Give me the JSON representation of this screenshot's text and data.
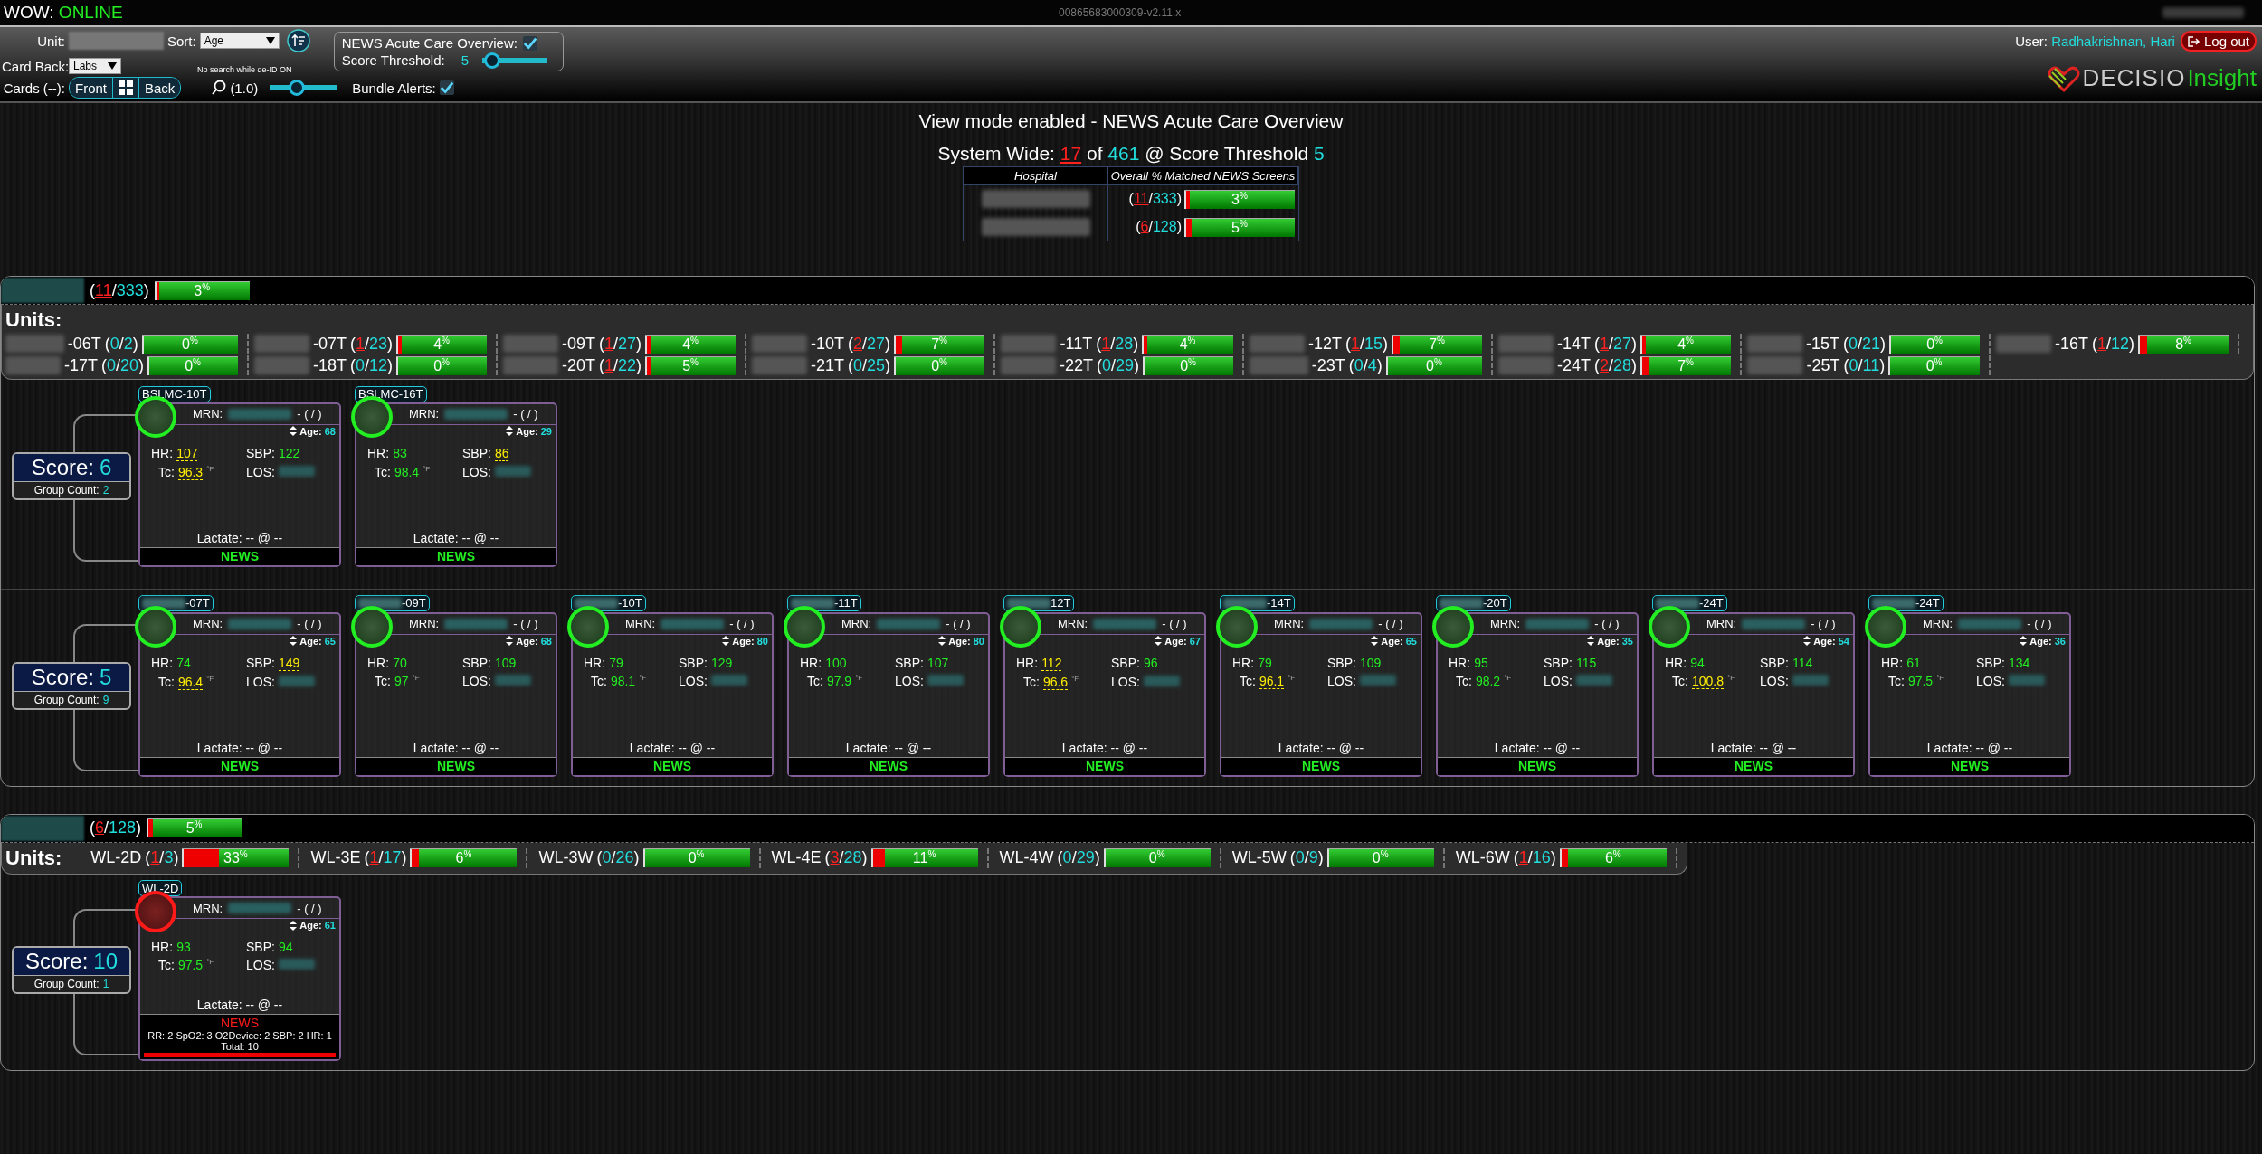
{
  "topbar": {
    "status_label": "WOW:",
    "status": "ONLINE",
    "build": "00865683000309-v2.11.x"
  },
  "toolbar": {
    "unit_label": "Unit:",
    "sort_label": "Sort:",
    "sort_value": "Age",
    "card_back_label": "Card Back:",
    "card_back_value": "Labs",
    "search_note": "No search while de-ID ON",
    "cards_label": "Cards (--):",
    "card_buttons": [
      {
        "kind": "text",
        "label": "Front"
      },
      {
        "kind": "grid"
      },
      {
        "kind": "text",
        "label": "Back"
      }
    ],
    "zoom_label": "(1.0)",
    "zoom": {
      "level": 0.4
    },
    "bundle": {
      "label": "Bundle Alerts:",
      "checked": true
    },
    "overview": {
      "label": "NEWS Acute Care Overview:",
      "checked": true
    },
    "threshold": {
      "label": "Score Threshold:",
      "value": "5",
      "level": 0.15
    }
  },
  "user": {
    "label": "User:",
    "name": "Radhakrishnan, Hari",
    "logout": "Log out"
  },
  "logo": {
    "part_1": "DECISIO",
    "part_2": "Insight"
  },
  "symbols": {
    "open": "(",
    "sep": "/",
    "close": ")"
  },
  "summary": {
    "title": "View mode enabled - NEWS Acute Care Overview",
    "label": "System Wide:",
    "matched": "17",
    "of": "of",
    "total": "461",
    "threshold_label": "@ Score Threshold",
    "threshold": "5",
    "columns": [
      "Hospital",
      "Overall % Matched NEWS Screens"
    ],
    "rows": [
      {
        "matched": "11",
        "total": "333",
        "percent": "3$^{%}$",
        "level": 0.03
      },
      {
        "matched": "6",
        "total": "128",
        "percent": "5$^{%}$",
        "level": 0.05
      }
    ]
  },
  "hospitals": [
    {
      "matched": "11",
      "total": "333",
      "percent": "3$^{%}$",
      "level": 0.03,
      "units_title": "Units:",
      "units": [
        {
          "name": "-06T",
          "redacted_prefix": true,
          "flagged": false,
          "matched": "0",
          "total": "2",
          "percent": "0$^{%}$",
          "level": 0
        },
        {
          "name": "-07T",
          "redacted_prefix": true,
          "flagged": true,
          "matched": "1",
          "total": "23",
          "percent": "4$^{%}$",
          "level": 0.04
        },
        {
          "name": "-09T",
          "redacted_prefix": true,
          "flagged": true,
          "matched": "1",
          "total": "27",
          "percent": "4$^{%}$",
          "level": 0.04
        },
        {
          "name": "-10T",
          "redacted_prefix": true,
          "flagged": true,
          "matched": "2",
          "total": "27",
          "percent": "7$^{%}$",
          "level": 0.07
        },
        {
          "name": "-11T",
          "redacted_prefix": true,
          "flagged": true,
          "matched": "1",
          "total": "28",
          "percent": "4$^{%}$",
          "level": 0.04
        },
        {
          "name": "-12T",
          "redacted_prefix": true,
          "flagged": true,
          "matched": "1",
          "total": "15",
          "percent": "7$^{%}$",
          "level": 0.07
        },
        {
          "name": "-14T",
          "redacted_prefix": true,
          "flagged": true,
          "matched": "1",
          "total": "27",
          "percent": "4$^{%}$",
          "level": 0.04
        },
        {
          "name": "-15T",
          "redacted_prefix": true,
          "flagged": false,
          "matched": "0",
          "total": "21",
          "percent": "0$^{%}$",
          "level": 0
        },
        {
          "name": "-16T",
          "redacted_prefix": true,
          "flagged": true,
          "matched": "1",
          "total": "12",
          "percent": "8$^{%}$",
          "level": 0.08
        },
        {
          "name": "-17T",
          "redacted_prefix": true,
          "flagged": false,
          "matched": "0",
          "total": "20",
          "percent": "0$^{%}$",
          "level": 0
        },
        {
          "name": "-18T",
          "redacted_prefix": true,
          "flagged": false,
          "matched": "0",
          "total": "12",
          "percent": "0$^{%}$",
          "level": 0
        },
        {
          "name": "-20T",
          "redacted_prefix": true,
          "flagged": true,
          "matched": "1",
          "total": "22",
          "percent": "5$^{%}$",
          "level": 0.05
        },
        {
          "name": "-21T",
          "redacted_prefix": true,
          "flagged": false,
          "matched": "0",
          "total": "25",
          "percent": "0$^{%}$",
          "level": 0
        },
        {
          "name": "-22T",
          "redacted_prefix": true,
          "flagged": false,
          "matched": "0",
          "total": "29",
          "percent": "0$^{%}$",
          "level": 0
        },
        {
          "name": "-23T",
          "redacted_prefix": true,
          "flagged": false,
          "matched": "0",
          "total": "4",
          "percent": "0$^{%}$",
          "level": 0
        },
        {
          "name": "-24T",
          "redacted_prefix": true,
          "flagged": true,
          "matched": "2",
          "total": "28",
          "percent": "7$^{%}$",
          "level": 0.07
        },
        {
          "name": "-25T",
          "redacted_prefix": true,
          "flagged": false,
          "matched": "0",
          "total": "11",
          "percent": "0$^{%}$",
          "level": 0
        }
      ],
      "groups": [
        {
          "score_label": "Score:",
          "score": "6",
          "count_label": "Group Count:",
          "count": "2",
          "cards": [
            {
              "tag": "BSLMC-10T",
              "redacted_prefix": false,
              "alert": false,
              "mrn_label": "MRN:",
              "mrn_tail": "- ( / )",
              "age_label": "Age:",
              "age": "68",
              "vitals": [
                {
                  "kind": "value",
                  "label": "HR:",
                  "value": "107",
                  "abnormal": true
                },
                {
                  "kind": "value",
                  "label": "SBP:",
                  "value": "122",
                  "abnormal": false
                },
                {
                  "kind": "value",
                  "label": "Tc:",
                  "value": "96.3",
                  "unit": "°F",
                  "abnormal": true
                },
                {
                  "kind": "redacted",
                  "label": "LOS:"
                }
              ],
              "lactate": "Lactate: -- @ --",
              "footer": "NEWS"
            },
            {
              "tag": "BSLMC-16T",
              "redacted_prefix": false,
              "alert": false,
              "mrn_label": "MRN:",
              "mrn_tail": "- ( / )",
              "age_label": "Age:",
              "age": "29",
              "vitals": [
                {
                  "kind": "value",
                  "label": "HR:",
                  "value": "83",
                  "abnormal": false
                },
                {
                  "kind": "value",
                  "label": "SBP:",
                  "value": "86",
                  "abnormal": true
                },
                {
                  "kind": "value",
                  "label": "Tc:",
                  "value": "98.4",
                  "unit": "°F",
                  "abnormal": false
                },
                {
                  "kind": "redacted",
                  "label": "LOS:"
                }
              ],
              "lactate": "Lactate: -- @ --",
              "footer": "NEWS"
            }
          ]
        },
        {
          "score_label": "Score:",
          "score": "5",
          "count_label": "Group Count:",
          "count": "9",
          "cards": [
            {
              "tag": "-07T",
              "redacted_prefix": true,
              "alert": false,
              "mrn_label": "MRN:",
              "mrn_tail": "- ( / )",
              "age_label": "Age:",
              "age": "65",
              "vitals": [
                {
                  "kind": "value",
                  "label": "HR:",
                  "value": "74",
                  "abnormal": false
                },
                {
                  "kind": "value",
                  "label": "SBP:",
                  "value": "149",
                  "abnormal": true
                },
                {
                  "kind": "value",
                  "label": "Tc:",
                  "value": "96.4",
                  "unit": "°F",
                  "abnormal": true
                },
                {
                  "kind": "redacted",
                  "label": "LOS:"
                }
              ],
              "lactate": "Lactate: -- @ --",
              "footer": "NEWS"
            },
            {
              "tag": "-09T",
              "redacted_prefix": true,
              "alert": false,
              "mrn_label": "MRN:",
              "mrn_tail": "- ( / )",
              "age_label": "Age:",
              "age": "68",
              "vitals": [
                {
                  "kind": "value",
                  "label": "HR:",
                  "value": "70",
                  "abnormal": false
                },
                {
                  "kind": "value",
                  "label": "SBP:",
                  "value": "109",
                  "abnormal": false
                },
                {
                  "kind": "value",
                  "label": "Tc:",
                  "value": "97",
                  "unit": "°F",
                  "abnormal": false
                },
                {
                  "kind": "redacted",
                  "label": "LOS:"
                }
              ],
              "lactate": "Lactate: -- @ --",
              "footer": "NEWS"
            },
            {
              "tag": "-10T",
              "redacted_prefix": true,
              "alert": false,
              "mrn_label": "MRN:",
              "mrn_tail": "- ( / )",
              "age_label": "Age:",
              "age": "80",
              "vitals": [
                {
                  "kind": "value",
                  "label": "HR:",
                  "value": "79",
                  "abnormal": false
                },
                {
                  "kind": "value",
                  "label": "SBP:",
                  "value": "129",
                  "abnormal": false
                },
                {
                  "kind": "value",
                  "label": "Tc:",
                  "value": "98.1",
                  "unit": "°F",
                  "abnormal": false
                },
                {
                  "kind": "redacted",
                  "label": "LOS:"
                }
              ],
              "lactate": "Lactate: -- @ --",
              "footer": "NEWS"
            },
            {
              "tag": "-11T",
              "redacted_prefix": true,
              "alert": false,
              "mrn_label": "MRN:",
              "mrn_tail": "- ( / )",
              "age_label": "Age:",
              "age": "80",
              "vitals": [
                {
                  "kind": "value",
                  "label": "HR:",
                  "value": "100",
                  "abnormal": false
                },
                {
                  "kind": "value",
                  "label": "SBP:",
                  "value": "107",
                  "abnormal": false
                },
                {
                  "kind": "value",
                  "label": "Tc:",
                  "value": "97.9",
                  "unit": "°F",
                  "abnormal": false
                },
                {
                  "kind": "redacted",
                  "label": "LOS:"
                }
              ],
              "lactate": "Lactate: -- @ --",
              "footer": "NEWS"
            },
            {
              "tag": "12T",
              "redacted_prefix": true,
              "alert": false,
              "mrn_label": "MRN:",
              "mrn_tail": "- ( / )",
              "age_label": "Age:",
              "age": "67",
              "vitals": [
                {
                  "kind": "value",
                  "label": "HR:",
                  "value": "112",
                  "abnormal": true
                },
                {
                  "kind": "value",
                  "label": "SBP:",
                  "value": "96",
                  "abnormal": false
                },
                {
                  "kind": "value",
                  "label": "Tc:",
                  "value": "96.6",
                  "unit": "°F",
                  "abnormal": true
                },
                {
                  "kind": "redacted",
                  "label": "LOS:"
                }
              ],
              "lactate": "Lactate: -- @ --",
              "footer": "NEWS"
            },
            {
              "tag": "-14T",
              "redacted_prefix": true,
              "alert": false,
              "mrn_label": "MRN:",
              "mrn_tail": "- ( / )",
              "age_label": "Age:",
              "age": "65",
              "vitals": [
                {
                  "kind": "value",
                  "label": "HR:",
                  "value": "79",
                  "abnormal": false
                },
                {
                  "kind": "value",
                  "label": "SBP:",
                  "value": "109",
                  "abnormal": false
                },
                {
                  "kind": "value",
                  "label": "Tc:",
                  "value": "96.1",
                  "unit": "°F",
                  "abnormal": true
                },
                {
                  "kind": "redacted",
                  "label": "LOS:"
                }
              ],
              "lactate": "Lactate: -- @ --",
              "footer": "NEWS"
            },
            {
              "tag": "-20T",
              "redacted_prefix": true,
              "alert": false,
              "mrn_label": "MRN:",
              "mrn_tail": "- ( / )",
              "age_label": "Age:",
              "age": "35",
              "vitals": [
                {
                  "kind": "value",
                  "label": "HR:",
                  "value": "95",
                  "abnormal": false
                },
                {
                  "kind": "value",
                  "label": "SBP:",
                  "value": "115",
                  "abnormal": false
                },
                {
                  "kind": "value",
                  "label": "Tc:",
                  "value": "98.2",
                  "unit": "°F",
                  "abnormal": false
                },
                {
                  "kind": "redacted",
                  "label": "LOS:"
                }
              ],
              "lactate": "Lactate: -- @ --",
              "footer": "NEWS"
            },
            {
              "tag": "-24T",
              "redacted_prefix": true,
              "alert": false,
              "mrn_label": "MRN:",
              "mrn_tail": "- ( / )",
              "age_label": "Age:",
              "age": "54",
              "vitals": [
                {
                  "kind": "value",
                  "label": "HR:",
                  "value": "94",
                  "abnormal": false
                },
                {
                  "kind": "value",
                  "label": "SBP:",
                  "value": "114",
                  "abnormal": false
                },
                {
                  "kind": "value",
                  "label": "Tc:",
                  "value": "100.8",
                  "unit": "°F",
                  "abnormal": true
                },
                {
                  "kind": "redacted",
                  "label": "LOS:"
                }
              ],
              "lactate": "Lactate: -- @ --",
              "footer": "NEWS"
            },
            {
              "tag": "-24T",
              "redacted_prefix": true,
              "alert": false,
              "mrn_label": "MRN:",
              "mrn_tail": "- ( / )",
              "age_label": "Age:",
              "age": "36",
              "vitals": [
                {
                  "kind": "value",
                  "label": "HR:",
                  "value": "61",
                  "abnormal": false
                },
                {
                  "kind": "value",
                  "label": "SBP:",
                  "value": "134",
                  "abnormal": false
                },
                {
                  "kind": "value",
                  "label": "Tc:",
                  "value": "97.5",
                  "unit": "°F",
                  "abnormal": false
                },
                {
                  "kind": "redacted",
                  "label": "LOS:"
                }
              ],
              "lactate": "Lactate: -- @ --",
              "footer": "NEWS"
            }
          ]
        }
      ]
    },
    {
      "matched": "6",
      "total": "128",
      "percent": "5$^{%}$",
      "level": 0.05,
      "units_title": "Units:",
      "units": [
        {
          "name": "WL-2D",
          "redacted_prefix": false,
          "flagged": true,
          "matched": "1",
          "total": "3",
          "percent": "33$^{%}$",
          "level": 0.33
        },
        {
          "name": "WL-3E",
          "redacted_prefix": false,
          "flagged": true,
          "matched": "1",
          "total": "17",
          "percent": "6$^{%}$",
          "level": 0.06
        },
        {
          "name": "WL-3W",
          "redacted_prefix": false,
          "flagged": false,
          "matched": "0",
          "total": "26",
          "percent": "0$^{%}$",
          "level": 0
        },
        {
          "name": "WL-4E",
          "redacted_prefix": false,
          "flagged": true,
          "matched": "3",
          "total": "28",
          "percent": "11$^{%}$",
          "level": 0.11
        },
        {
          "name": "WL-4W",
          "redacted_prefix": false,
          "flagged": false,
          "matched": "0",
          "total": "29",
          "percent": "0$^{%}$",
          "level": 0
        },
        {
          "name": "WL-5W",
          "redacted_prefix": false,
          "flagged": false,
          "matched": "0",
          "total": "9",
          "percent": "0$^{%}$",
          "level": 0
        },
        {
          "name": "WL-6W",
          "redacted_prefix": false,
          "flagged": true,
          "matched": "1",
          "total": "16",
          "percent": "6$^{%}$",
          "level": 0.06
        }
      ],
      "groups": [
        {
          "score_label": "Score:",
          "score": "10",
          "count_label": "Group Count:",
          "count": "1",
          "cards": [
            {
              "tag": "WL-2D",
              "redacted_prefix": false,
              "alert": true,
              "mrn_label": "MRN:",
              "mrn_tail": "- ( / )",
              "age_label": "Age:",
              "age": "61",
              "vitals": [
                {
                  "kind": "value",
                  "label": "HR:",
                  "value": "93",
                  "abnormal": false
                },
                {
                  "kind": "value",
                  "label": "SBP:",
                  "value": "94",
                  "abnormal": false
                },
                {
                  "kind": "value",
                  "label": "Tc:",
                  "value": "97.5",
                  "unit": "°F",
                  "abnormal": false
                },
                {
                  "kind": "redacted",
                  "label": "LOS:"
                }
              ],
              "lactate": "Lactate: -- @ --",
              "footer": "NEWS",
              "details": "RR: 2 SpO2: 3 O2Device: 2 SBP: 2 HR: 1",
              "total": "Total: 10"
            }
          ]
        }
      ]
    }
  ]
}
